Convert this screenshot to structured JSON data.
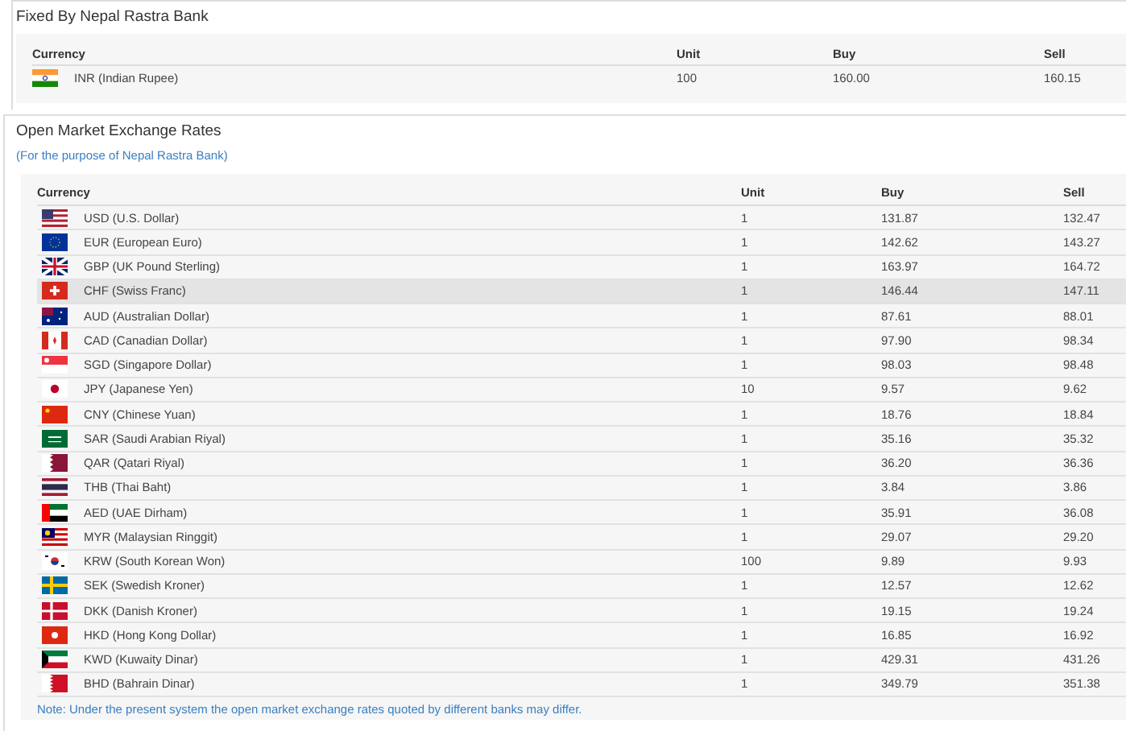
{
  "fixed_section": {
    "title": "Fixed By Nepal Rastra Bank",
    "table": {
      "columns": [
        "Currency",
        "Unit",
        "Buy",
        "Sell"
      ],
      "rows": [
        {
          "currency": "INR (Indian Rupee)",
          "unit": "100",
          "buy": "160.00",
          "sell": "160.15"
        }
      ]
    }
  },
  "open_market_section": {
    "title": "Open Market Exchange Rates",
    "subtitle": "(For the purpose of Nepal Rastra Bank)",
    "table": {
      "columns": [
        "Currency",
        "Unit",
        "Buy",
        "Sell"
      ],
      "rows": [
        {
          "currency": "USD (U.S. Dollar)",
          "unit": "1",
          "buy": "131.87",
          "sell": "132.47",
          "selected": false
        },
        {
          "currency": "EUR (European Euro)",
          "unit": "1",
          "buy": "142.62",
          "sell": "143.27",
          "selected": false
        },
        {
          "currency": "GBP (UK Pound Sterling)",
          "unit": "1",
          "buy": "163.97",
          "sell": "164.72",
          "selected": false
        },
        {
          "currency": "CHF (Swiss Franc)",
          "unit": "1",
          "buy": "146.44",
          "sell": "147.11",
          "selected": true
        },
        {
          "currency": "AUD (Australian Dollar)",
          "unit": "1",
          "buy": "87.61",
          "sell": "88.01",
          "selected": false
        },
        {
          "currency": "CAD (Canadian Dollar)",
          "unit": "1",
          "buy": "97.90",
          "sell": "98.34",
          "selected": false
        },
        {
          "currency": "SGD (Singapore Dollar)",
          "unit": "1",
          "buy": "98.03",
          "sell": "98.48",
          "selected": false
        },
        {
          "currency": "JPY (Japanese Yen)",
          "unit": "10",
          "buy": "9.57",
          "sell": "9.62",
          "selected": false
        },
        {
          "currency": "CNY (Chinese Yuan)",
          "unit": "1",
          "buy": "18.76",
          "sell": "18.84",
          "selected": false
        },
        {
          "currency": "SAR (Saudi Arabian Riyal)",
          "unit": "1",
          "buy": "35.16",
          "sell": "35.32",
          "selected": false
        },
        {
          "currency": "QAR (Qatari Riyal)",
          "unit": "1",
          "buy": "36.20",
          "sell": "36.36",
          "selected": false
        },
        {
          "currency": "THB (Thai Baht)",
          "unit": "1",
          "buy": "3.84",
          "sell": "3.86",
          "selected": false
        },
        {
          "currency": "AED (UAE Dirham)",
          "unit": "1",
          "buy": "35.91",
          "sell": "36.08",
          "selected": false
        },
        {
          "currency": "MYR (Malaysian Ringgit)",
          "unit": "1",
          "buy": "29.07",
          "sell": "29.20",
          "selected": false
        },
        {
          "currency": "KRW (South Korean Won)",
          "unit": "100",
          "buy": "9.89",
          "sell": "9.93",
          "selected": false
        },
        {
          "currency": "SEK (Swedish Kroner)",
          "unit": "1",
          "buy": "12.57",
          "sell": "12.62",
          "selected": false
        },
        {
          "currency": "DKK (Danish Kroner)",
          "unit": "1",
          "buy": "19.15",
          "sell": "19.24",
          "selected": false
        },
        {
          "currency": "HKD (Hong Kong Dollar)",
          "unit": "1",
          "buy": "16.85",
          "sell": "16.92",
          "selected": false
        },
        {
          "currency": "KWD (Kuwaity Dinar)",
          "unit": "1",
          "buy": "429.31",
          "sell": "431.26",
          "selected": false
        },
        {
          "currency": "BHD (Bahrain Dinar)",
          "unit": "1",
          "buy": "349.79",
          "sell": "351.38",
          "selected": false
        }
      ]
    },
    "note": "Note: Under the present system the open market exchange rates quoted by different banks may differ."
  }
}
